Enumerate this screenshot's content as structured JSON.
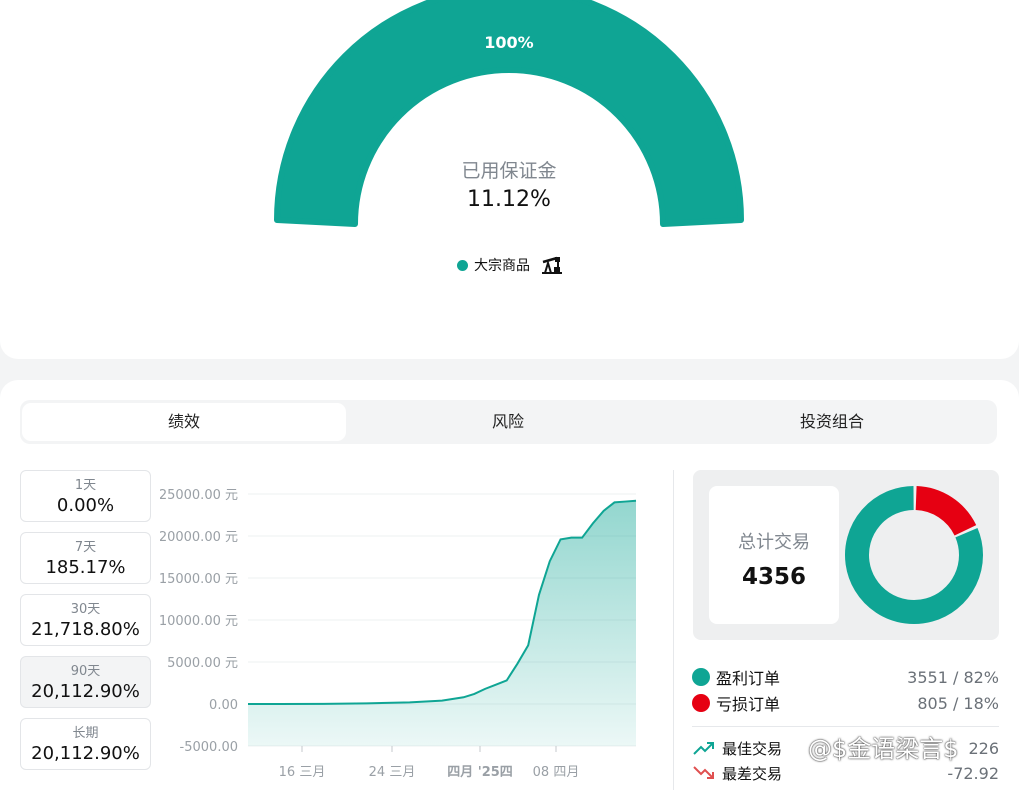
{
  "margin": {
    "gauge_percent": "100%",
    "label": "已用保证金",
    "value": "11.12%",
    "legend_label": "大宗商品",
    "fill_fraction": 1.0,
    "color": "#0fa594"
  },
  "tabs": [
    {
      "label": "绩效",
      "active": true
    },
    {
      "label": "风险",
      "active": false
    },
    {
      "label": "投资组合",
      "active": false
    }
  ],
  "periods": [
    {
      "label": "1天",
      "value": "0.00%"
    },
    {
      "label": "7天",
      "value": "185.17%"
    },
    {
      "label": "30天",
      "value": "21,718.80%"
    },
    {
      "label": "90天",
      "value": "20,112.90%"
    },
    {
      "label": "长期",
      "value": "20,112.90%"
    }
  ],
  "chart_data": {
    "type": "area",
    "y_tick_labels": [
      "-5000.00",
      "0.00",
      "5000.00 元",
      "10000.00 元",
      "15000.00 元",
      "20000.00 元",
      "25000.00 元"
    ],
    "y_ticks": [
      -5000,
      0,
      5000,
      10000,
      15000,
      20000,
      25000
    ],
    "ylim": [
      -5000,
      25000
    ],
    "x_tick_labels": [
      "16 三月",
      "24 三月",
      "四月 '25四",
      "08 四月"
    ],
    "x": [
      "03-13",
      "03-16",
      "03-20",
      "03-24",
      "03-28",
      "03-31",
      "04-02",
      "04-03",
      "04-04",
      "04-05",
      "04-06",
      "04-07",
      "04-08",
      "04-09",
      "04-10",
      "04-11",
      "04-12",
      "04-13",
      "04-14",
      "04-15",
      "04-16",
      "04-17",
      "04-18"
    ],
    "values": [
      0,
      0,
      20,
      80,
      200,
      400,
      800,
      1200,
      1800,
      2300,
      2800,
      4800,
      7000,
      13000,
      17000,
      19600,
      19800,
      19800,
      21500,
      23000,
      24000,
      24100,
      24200
    ],
    "color": "#0fa594"
  },
  "totals": {
    "label": "总计交易",
    "value": "4356"
  },
  "orders": [
    {
      "label": "盈利订单",
      "value": "3551 / 82%",
      "color": "#0fa594",
      "fraction": 0.82
    },
    {
      "label": "亏损订单",
      "value": "805 / 18%",
      "color": "#e60012",
      "fraction": 0.18
    }
  ],
  "trades": [
    {
      "label": "最佳交易",
      "value": "226",
      "icon": "trend-up-icon",
      "color": "#0fa594"
    },
    {
      "label": "最差交易",
      "value": "-72.92",
      "icon": "trend-down-icon",
      "color": "#e05050"
    }
  ],
  "watermark": "@$金语梁言$"
}
